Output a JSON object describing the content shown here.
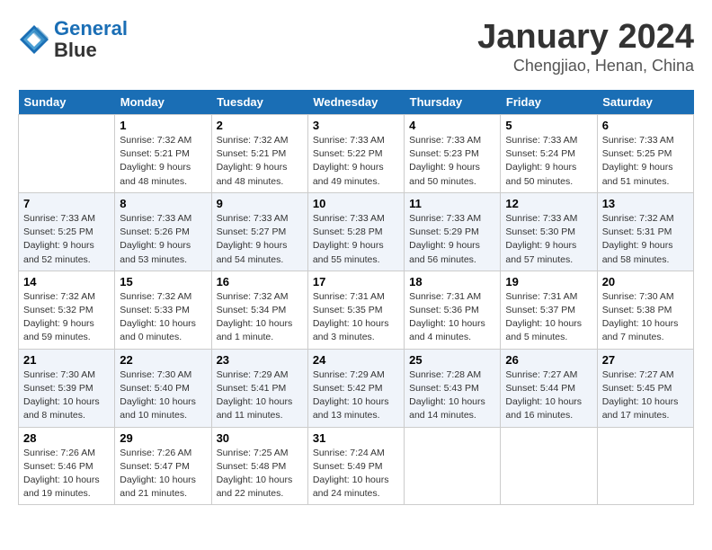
{
  "logo": {
    "line1": "General",
    "line2": "Blue"
  },
  "title": "January 2024",
  "subtitle": "Chengjiao, Henan, China",
  "headers": [
    "Sunday",
    "Monday",
    "Tuesday",
    "Wednesday",
    "Thursday",
    "Friday",
    "Saturday"
  ],
  "weeks": [
    [
      {
        "day": "",
        "info": ""
      },
      {
        "day": "1",
        "info": "Sunrise: 7:32 AM\nSunset: 5:21 PM\nDaylight: 9 hours\nand 48 minutes."
      },
      {
        "day": "2",
        "info": "Sunrise: 7:32 AM\nSunset: 5:21 PM\nDaylight: 9 hours\nand 48 minutes."
      },
      {
        "day": "3",
        "info": "Sunrise: 7:33 AM\nSunset: 5:22 PM\nDaylight: 9 hours\nand 49 minutes."
      },
      {
        "day": "4",
        "info": "Sunrise: 7:33 AM\nSunset: 5:23 PM\nDaylight: 9 hours\nand 50 minutes."
      },
      {
        "day": "5",
        "info": "Sunrise: 7:33 AM\nSunset: 5:24 PM\nDaylight: 9 hours\nand 50 minutes."
      },
      {
        "day": "6",
        "info": "Sunrise: 7:33 AM\nSunset: 5:25 PM\nDaylight: 9 hours\nand 51 minutes."
      }
    ],
    [
      {
        "day": "7",
        "info": "Sunrise: 7:33 AM\nSunset: 5:25 PM\nDaylight: 9 hours\nand 52 minutes."
      },
      {
        "day": "8",
        "info": "Sunrise: 7:33 AM\nSunset: 5:26 PM\nDaylight: 9 hours\nand 53 minutes."
      },
      {
        "day": "9",
        "info": "Sunrise: 7:33 AM\nSunset: 5:27 PM\nDaylight: 9 hours\nand 54 minutes."
      },
      {
        "day": "10",
        "info": "Sunrise: 7:33 AM\nSunset: 5:28 PM\nDaylight: 9 hours\nand 55 minutes."
      },
      {
        "day": "11",
        "info": "Sunrise: 7:33 AM\nSunset: 5:29 PM\nDaylight: 9 hours\nand 56 minutes."
      },
      {
        "day": "12",
        "info": "Sunrise: 7:33 AM\nSunset: 5:30 PM\nDaylight: 9 hours\nand 57 minutes."
      },
      {
        "day": "13",
        "info": "Sunrise: 7:32 AM\nSunset: 5:31 PM\nDaylight: 9 hours\nand 58 minutes."
      }
    ],
    [
      {
        "day": "14",
        "info": "Sunrise: 7:32 AM\nSunset: 5:32 PM\nDaylight: 9 hours\nand 59 minutes."
      },
      {
        "day": "15",
        "info": "Sunrise: 7:32 AM\nSunset: 5:33 PM\nDaylight: 10 hours\nand 0 minutes."
      },
      {
        "day": "16",
        "info": "Sunrise: 7:32 AM\nSunset: 5:34 PM\nDaylight: 10 hours\nand 1 minute."
      },
      {
        "day": "17",
        "info": "Sunrise: 7:31 AM\nSunset: 5:35 PM\nDaylight: 10 hours\nand 3 minutes."
      },
      {
        "day": "18",
        "info": "Sunrise: 7:31 AM\nSunset: 5:36 PM\nDaylight: 10 hours\nand 4 minutes."
      },
      {
        "day": "19",
        "info": "Sunrise: 7:31 AM\nSunset: 5:37 PM\nDaylight: 10 hours\nand 5 minutes."
      },
      {
        "day": "20",
        "info": "Sunrise: 7:30 AM\nSunset: 5:38 PM\nDaylight: 10 hours\nand 7 minutes."
      }
    ],
    [
      {
        "day": "21",
        "info": "Sunrise: 7:30 AM\nSunset: 5:39 PM\nDaylight: 10 hours\nand 8 minutes."
      },
      {
        "day": "22",
        "info": "Sunrise: 7:30 AM\nSunset: 5:40 PM\nDaylight: 10 hours\nand 10 minutes."
      },
      {
        "day": "23",
        "info": "Sunrise: 7:29 AM\nSunset: 5:41 PM\nDaylight: 10 hours\nand 11 minutes."
      },
      {
        "day": "24",
        "info": "Sunrise: 7:29 AM\nSunset: 5:42 PM\nDaylight: 10 hours\nand 13 minutes."
      },
      {
        "day": "25",
        "info": "Sunrise: 7:28 AM\nSunset: 5:43 PM\nDaylight: 10 hours\nand 14 minutes."
      },
      {
        "day": "26",
        "info": "Sunrise: 7:27 AM\nSunset: 5:44 PM\nDaylight: 10 hours\nand 16 minutes."
      },
      {
        "day": "27",
        "info": "Sunrise: 7:27 AM\nSunset: 5:45 PM\nDaylight: 10 hours\nand 17 minutes."
      }
    ],
    [
      {
        "day": "28",
        "info": "Sunrise: 7:26 AM\nSunset: 5:46 PM\nDaylight: 10 hours\nand 19 minutes."
      },
      {
        "day": "29",
        "info": "Sunrise: 7:26 AM\nSunset: 5:47 PM\nDaylight: 10 hours\nand 21 minutes."
      },
      {
        "day": "30",
        "info": "Sunrise: 7:25 AM\nSunset: 5:48 PM\nDaylight: 10 hours\nand 22 minutes."
      },
      {
        "day": "31",
        "info": "Sunrise: 7:24 AM\nSunset: 5:49 PM\nDaylight: 10 hours\nand 24 minutes."
      },
      {
        "day": "",
        "info": ""
      },
      {
        "day": "",
        "info": ""
      },
      {
        "day": "",
        "info": ""
      }
    ]
  ]
}
